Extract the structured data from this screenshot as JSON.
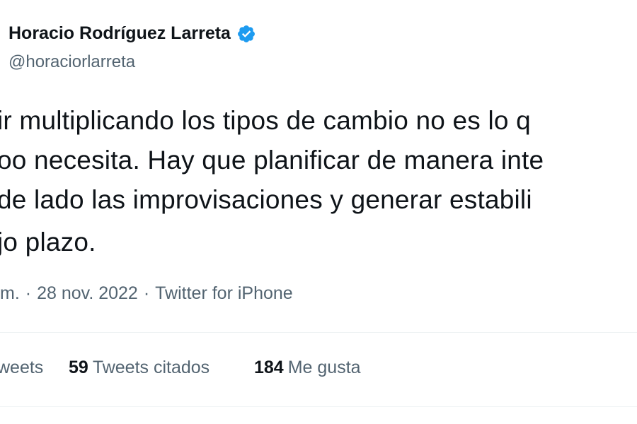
{
  "author": {
    "name": "Horacio Rodríguez Larreta",
    "handle": "@horaciorlarreta",
    "verified_color": "#1d9bf0"
  },
  "tweet": {
    "lines": [
      "ir multiplicando los tipos de cambio no es lo q",
      "oo necesita. Hay que planificar de manera inte",
      " de lado las improvisaciones y generar estabili",
      "jo plazo."
    ],
    "time_fragment": "m.",
    "separator": "·",
    "date": "28 nov. 2022",
    "source": "Twitter for iPhone"
  },
  "stats": {
    "retweets_label": "weets",
    "quote_count": "59",
    "quote_label": "Tweets citados",
    "like_count": "184",
    "like_label": "Me gusta"
  },
  "colors": {
    "text": "#0f1419",
    "secondary": "#536471",
    "divider": "#eff3f4"
  }
}
